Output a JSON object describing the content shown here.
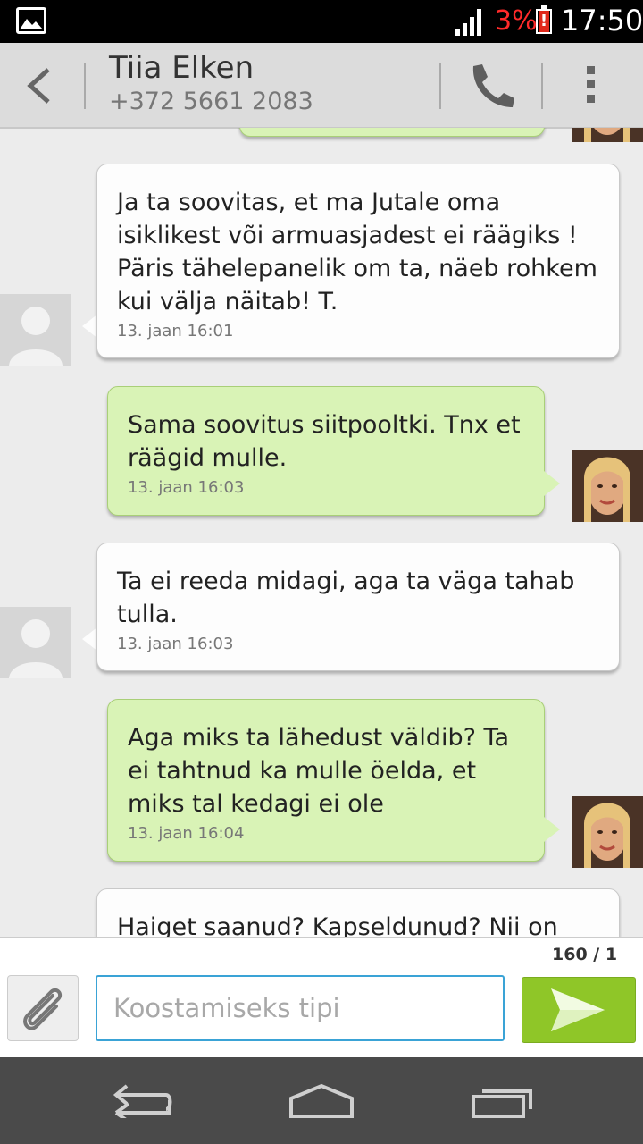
{
  "status_bar": {
    "battery_percent": "3%",
    "battery_alert": "!",
    "time": "17:50"
  },
  "header": {
    "contact_name": "Tiia Elken",
    "contact_phone": "+372 5661 2083"
  },
  "messages": [
    {
      "direction": "in",
      "text": "Ja ta soovitas, et ma Jutale oma isiklikest või armuasjadest ei räägiks ! Päris tähelepanelik om ta, näeb rohkem kui välja näitab! T.",
      "time": "13. jaan 16:01"
    },
    {
      "direction": "out",
      "text": "Sama soovitus siitpooltki. Tnx et räägid mulle.",
      "time": "13. jaan 16:03"
    },
    {
      "direction": "in",
      "text": "Ta ei reeda midagi, aga ta väga tahab tulla.",
      "time": "13. jaan 16:03"
    },
    {
      "direction": "out",
      "text": "Aga miks ta lähedust väldib? Ta ei tahtnud ka mulle öelda, et miks tal kedagi ei ole",
      "time": "13. jaan 16:04"
    },
    {
      "direction": "in",
      "text": "Haiget saanud? Kapseldunud? Nii on"
    }
  ],
  "composer": {
    "char_counter": "160 / 1",
    "placeholder": "Koostamiseks tipi"
  },
  "colors": {
    "incoming_bubble": "#fdfdfd",
    "outgoing_bubble": "#d9f3b6",
    "send_button": "#8fc628",
    "input_border": "#3aa3d6"
  }
}
